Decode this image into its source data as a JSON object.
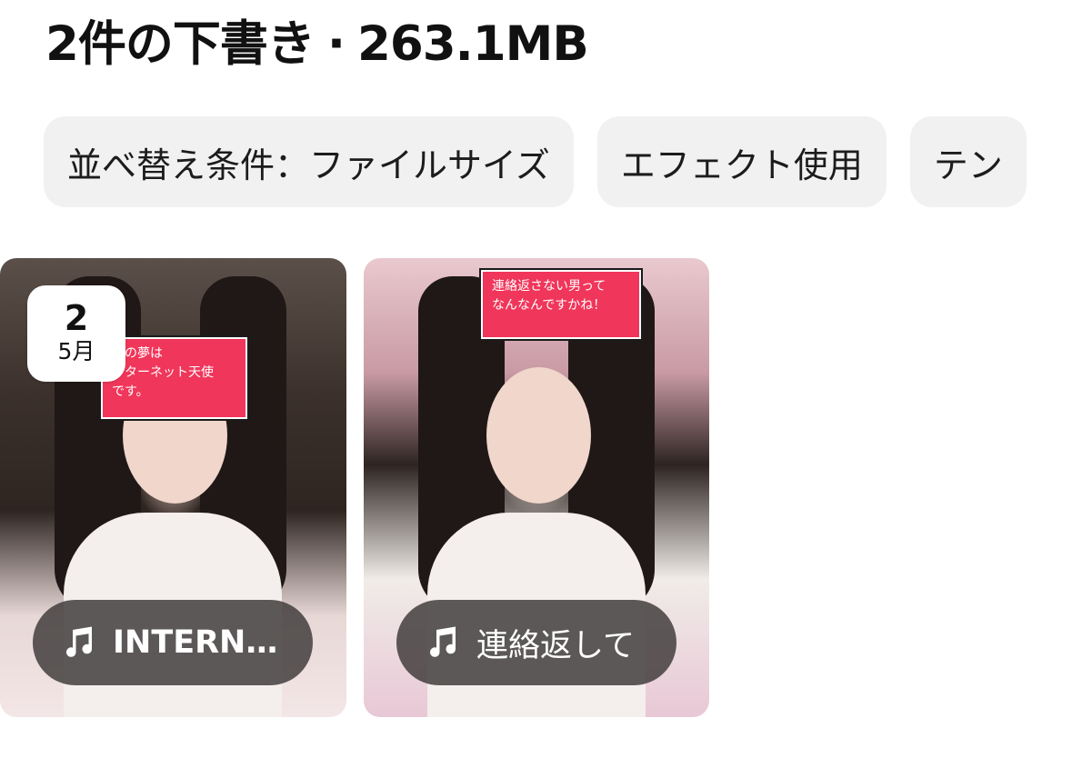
{
  "header": {
    "count_label": "2件の下書き",
    "separator": "·",
    "size_label": "263.1MB"
  },
  "filters": [
    {
      "label": "並べ替え条件：ファイルサイズ"
    },
    {
      "label": "エフェクト使用"
    },
    {
      "label": "テン"
    }
  ],
  "drafts": [
    {
      "date_day": "2",
      "date_month": "5月",
      "sticker_text": "来の夢は\nンターネット天使\nです。",
      "music_title": "INTERNE…",
      "music_icon": "music-note-icon"
    },
    {
      "sticker_text": "連絡返さない男って\nなんなんですかね！",
      "music_title": "連絡返して",
      "music_icon": "music-note-icon"
    }
  ],
  "colors": {
    "chip_background": "#f1f1f2",
    "sticker_pink": "#f0365a",
    "pill_background": "#3c3737"
  }
}
